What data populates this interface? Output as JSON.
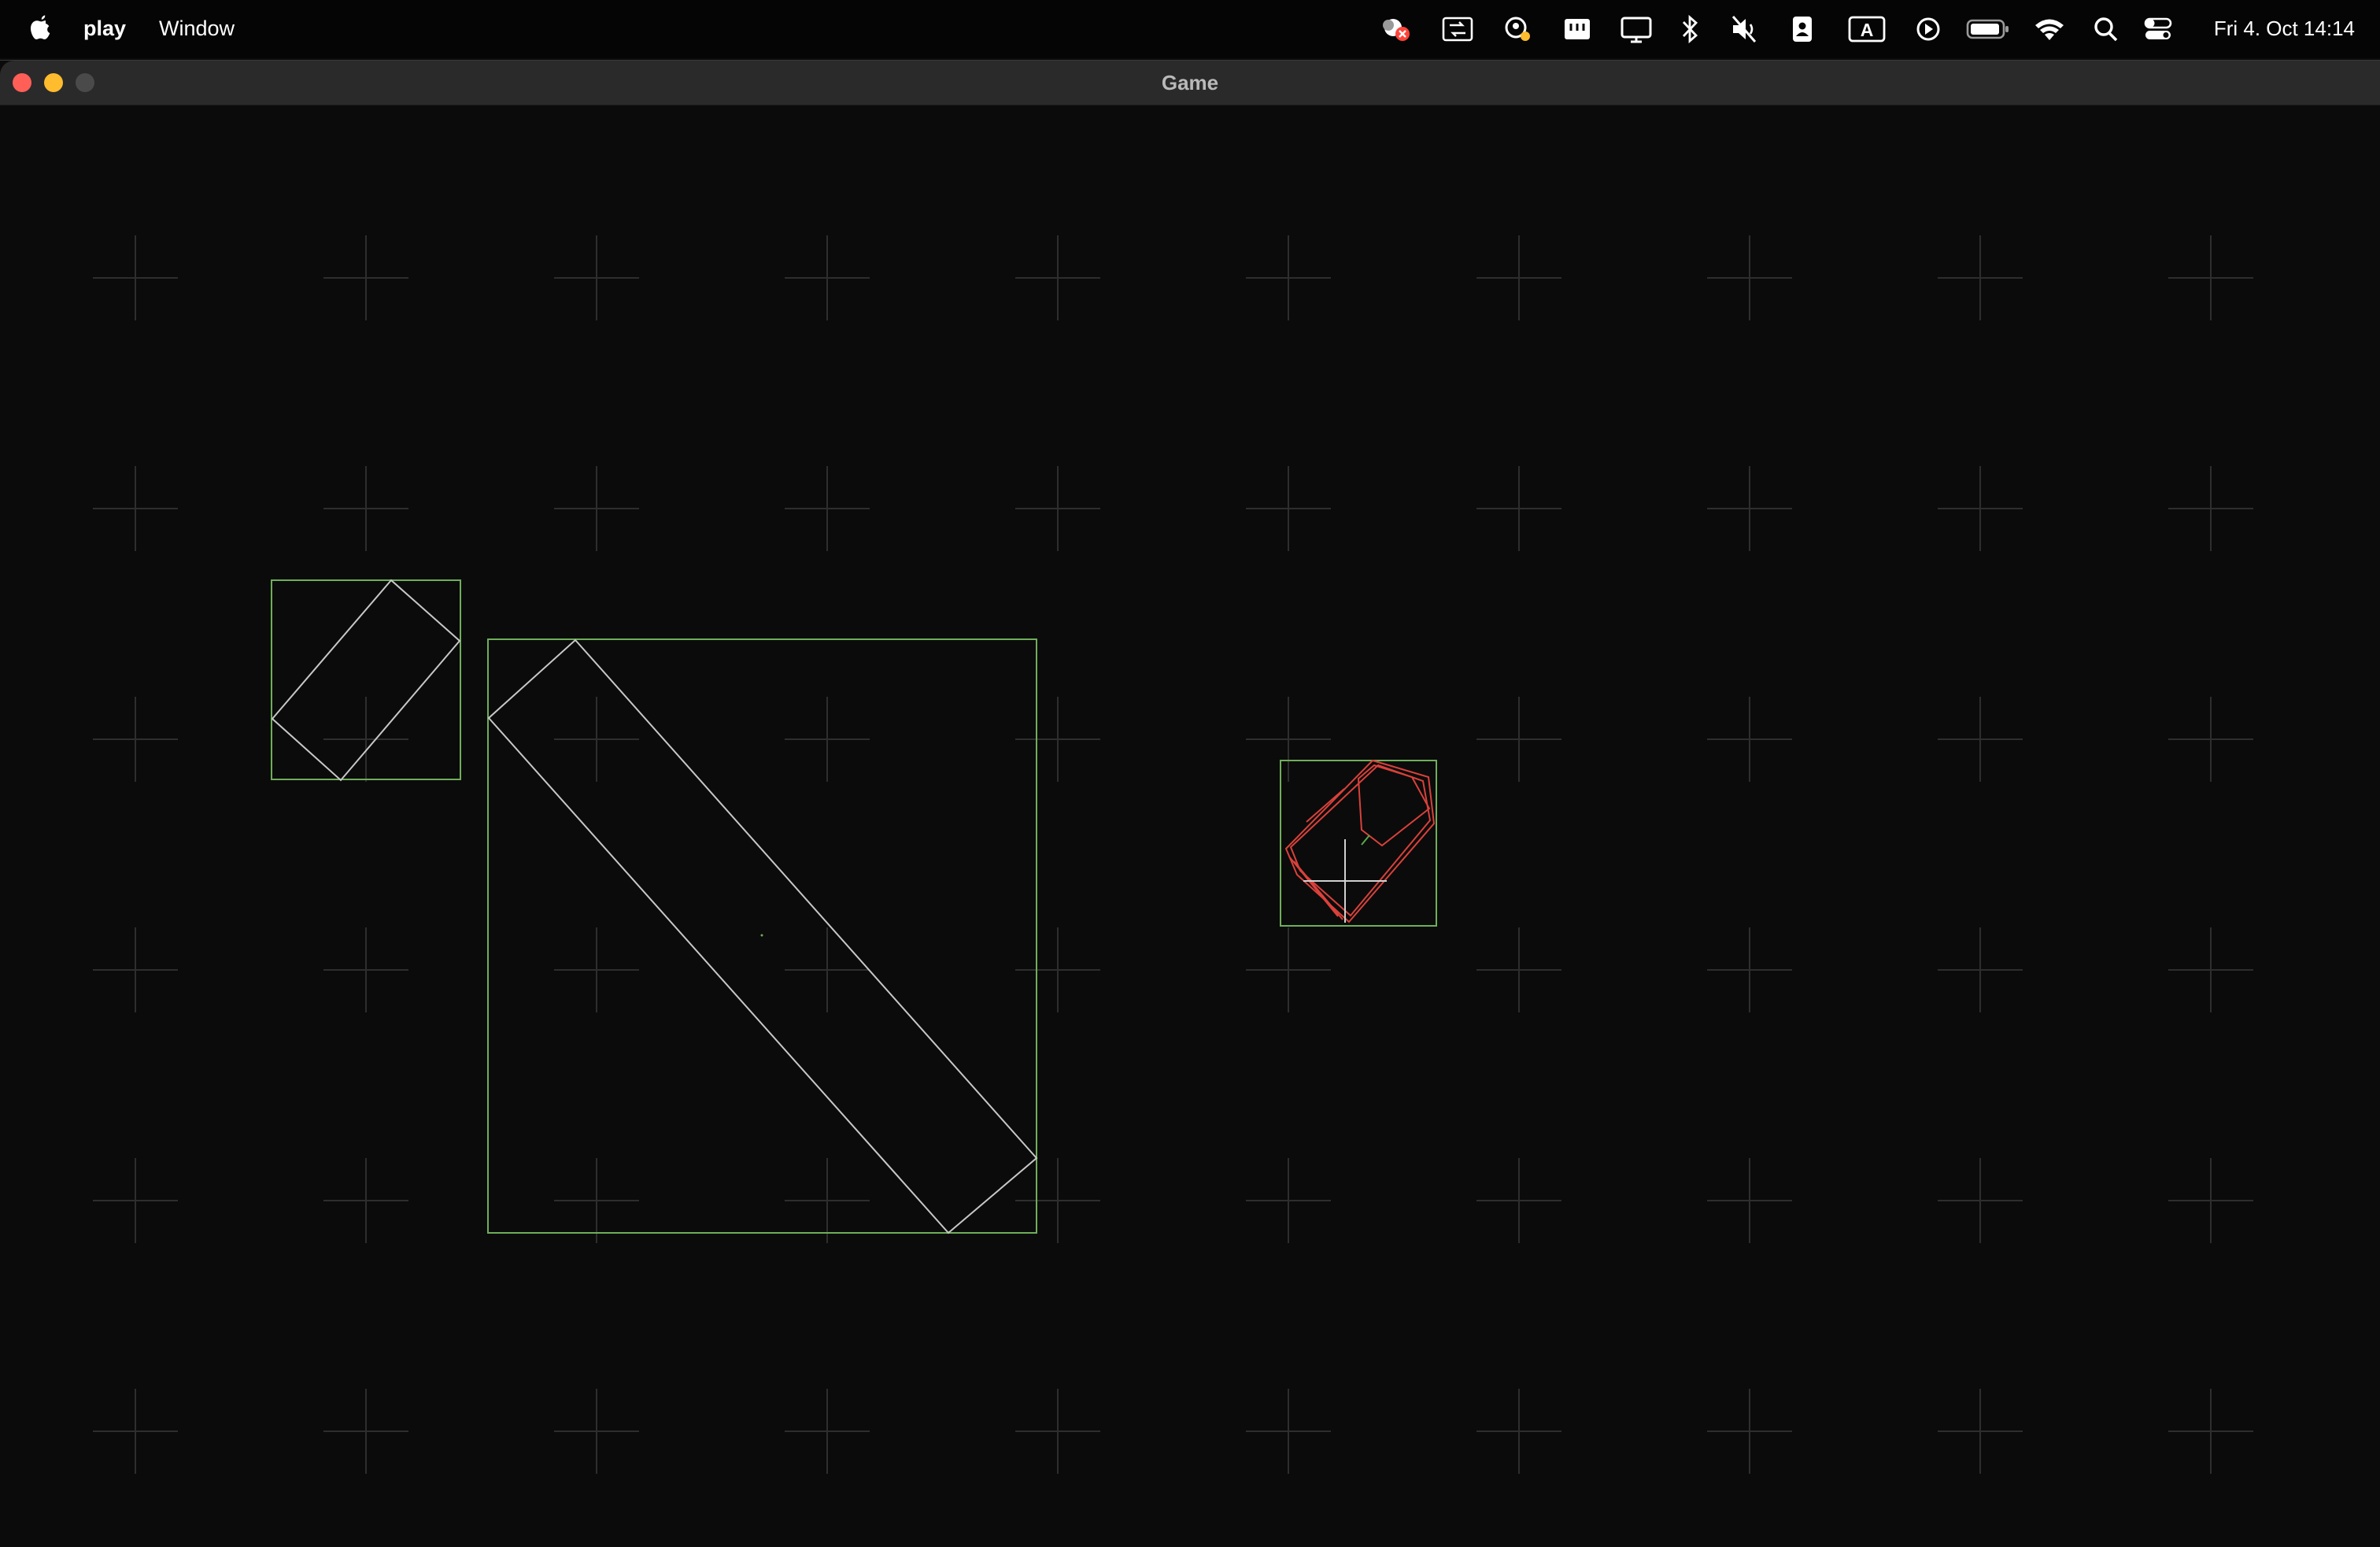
{
  "menubar": {
    "app_name": "play",
    "menu_items": [
      "Window"
    ],
    "clock": "Fri 4. Oct  14:14",
    "status_icons": [
      "screen-sharing-blocked-icon",
      "display-mirroring-icon",
      "account-warning-icon",
      "window-manager-icon",
      "display-icon",
      "bluetooth-icon",
      "sound-muted-icon",
      "contacts-icon",
      "input-source-icon",
      "now-playing-icon",
      "battery-icon",
      "wifi-icon",
      "spotlight-search-icon",
      "control-center-icon"
    ],
    "input_source_letter": "A"
  },
  "window": {
    "title": "Game",
    "traffic_colors": {
      "close": "#ff5f57",
      "minimize": "#febc2e",
      "zoom": "#4a4a4a"
    }
  },
  "game": {
    "background": "#0b0b0b",
    "colors": {
      "grid_cross": "#2e2e2e",
      "aabb": "#6fae5a",
      "body_outline": "#c8c8c8",
      "player_outline": "#d9413b",
      "player_cross": "#d0d0d0",
      "player_marker": "#5aa84a"
    }
  }
}
